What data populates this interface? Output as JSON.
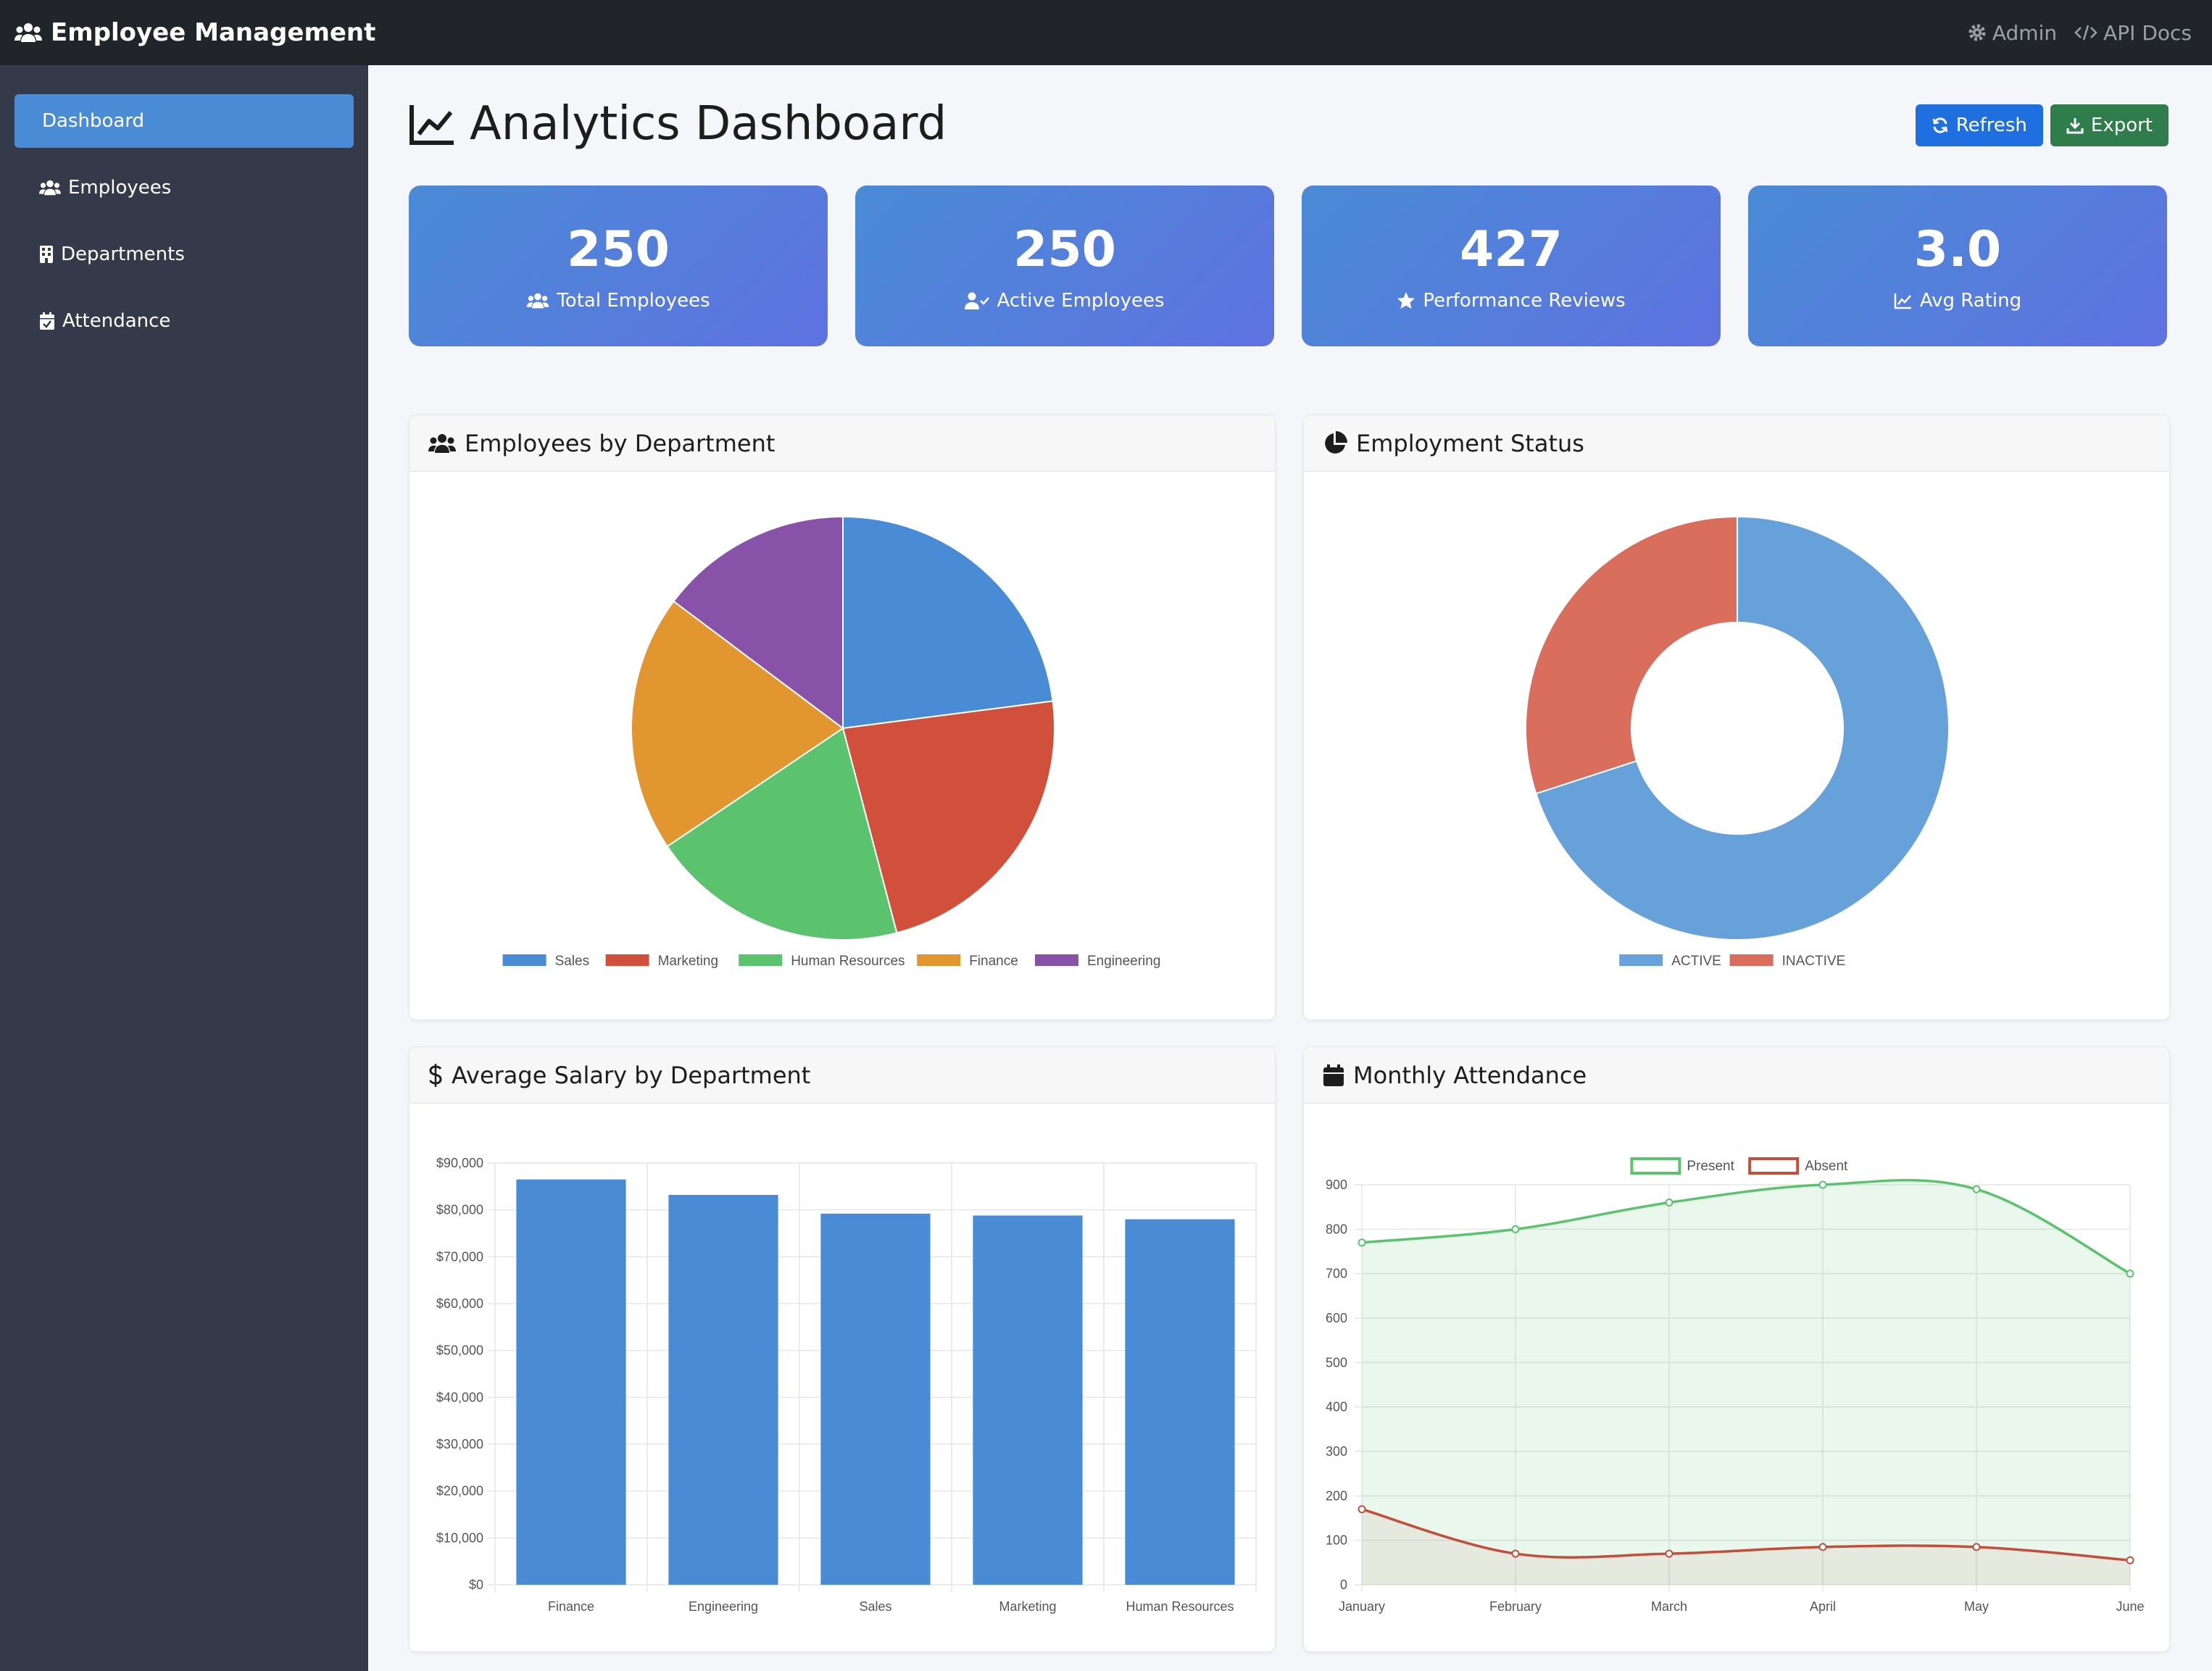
{
  "app": {
    "title": "Employee Management"
  },
  "topnav": {
    "admin_label": "Admin",
    "api_docs_label": "API Docs"
  },
  "sidebar": {
    "items": [
      {
        "label": "Dashboard",
        "icon": "none",
        "active": true
      },
      {
        "label": "Employees",
        "icon": "users-icon"
      },
      {
        "label": "Departments",
        "icon": "building-icon"
      },
      {
        "label": "Attendance",
        "icon": "calendar-check-icon"
      }
    ]
  },
  "page": {
    "title": "Analytics Dashboard"
  },
  "actions": {
    "refresh_label": "Refresh",
    "export_label": "Export"
  },
  "stats": [
    {
      "value": "250",
      "label": "Total Employees",
      "icon": "users-icon"
    },
    {
      "value": "250",
      "label": "Active Employees",
      "icon": "user-check-icon"
    },
    {
      "value": "427",
      "label": "Performance Reviews",
      "icon": "star-icon"
    },
    {
      "value": "3.0",
      "label": "Avg Rating",
      "icon": "chart-line-icon"
    }
  ],
  "cards": {
    "dept": {
      "title": "Employees by Department"
    },
    "status": {
      "title": "Employment Status"
    },
    "salary": {
      "title": "Average Salary by Department"
    },
    "attendance": {
      "title": "Monthly Attendance"
    }
  },
  "colors": {
    "accent": "#4a8bd6",
    "sidebar": "#343a4a",
    "topbar": "#212529",
    "btn_primary": "#1f6fe0",
    "btn_success": "#2e7d4a"
  },
  "chart_data": [
    {
      "id": "dept",
      "type": "pie",
      "title": "",
      "categories": [
        "Sales",
        "Marketing",
        "Human Resources",
        "Finance",
        "Engineering"
      ],
      "values": [
        56,
        56,
        48,
        48,
        36
      ],
      "colors": [
        "#4a8bd6",
        "#d1503c",
        "#5bc26e",
        "#e2962f",
        "#8752a8"
      ],
      "legend": "bottom"
    },
    {
      "id": "status",
      "type": "pie",
      "subtype": "doughnut",
      "title": "",
      "categories": [
        "ACTIVE",
        "INACTIVE"
      ],
      "values": [
        70,
        30
      ],
      "colors": [
        "#66a1d9",
        "#d96e5d"
      ],
      "legend": "bottom"
    },
    {
      "id": "salary",
      "type": "bar",
      "title": "",
      "categories": [
        "Finance",
        "Engineering",
        "Sales",
        "Marketing",
        "Human Resources"
      ],
      "values": [
        86500,
        83200,
        79200,
        78800,
        78000
      ],
      "ylim": [
        0,
        90000
      ],
      "yticks": [
        0,
        10000,
        20000,
        30000,
        40000,
        50000,
        60000,
        70000,
        80000,
        90000
      ],
      "ytick_labels": [
        "$0",
        "$10,000",
        "$20,000",
        "$30,000",
        "$40,000",
        "$50,000",
        "$60,000",
        "$70,000",
        "$80,000",
        "$90,000"
      ],
      "color": "#4a8bd6",
      "grid": true
    },
    {
      "id": "attendance",
      "type": "area",
      "title": "",
      "x": [
        "January",
        "February",
        "March",
        "April",
        "May",
        "June"
      ],
      "series": [
        {
          "name": "Present",
          "values": [
            770,
            800,
            860,
            900,
            890,
            700
          ],
          "color": "#5bc26e",
          "fill": "rgba(91,194,110,0.13)"
        },
        {
          "name": "Absent",
          "values": [
            170,
            70,
            70,
            85,
            85,
            55
          ],
          "color": "#c0503c",
          "fill": "rgba(192,80,60,0.08)"
        }
      ],
      "ylim": [
        0,
        900
      ],
      "yticks": [
        0,
        100,
        200,
        300,
        400,
        500,
        600,
        700,
        800,
        900
      ],
      "legend": "top",
      "grid": true
    }
  ]
}
